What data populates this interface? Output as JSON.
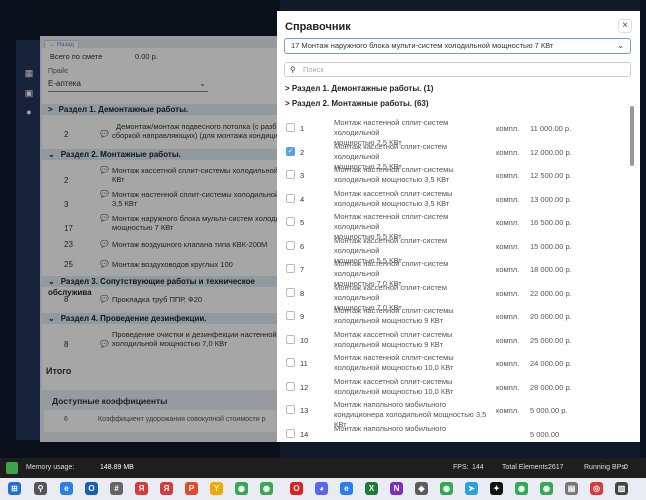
{
  "app": {
    "back_label": "Назад",
    "total_label": "Всего по смете",
    "total_value": "0.00 р.",
    "price_label": "Прайс",
    "price_value": "Е-аптека",
    "itogo": "Итого",
    "coef_title": "Доступные коэффициенты",
    "coef_num": "6",
    "coef_text": "Коэффициент удорожания совокупной стоимости р",
    "sections": [
      {
        "label": "Раздел 1. Демонтажные работы."
      },
      {
        "label": "Раздел 2. Монтажные работы."
      },
      {
        "label": "Раздел 3. Сопутствующие работы и техническое обслужива"
      },
      {
        "label": "Раздел 4. Проведение дезинфекции."
      }
    ],
    "rows": [
      {
        "num": "2",
        "line1": "Демонтаж/монтаж подвесного потолка (с разбор",
        "line2": "сборкой направляющих) (для монтажа кондицио"
      },
      {
        "num": "2",
        "line1": "Монтаж кассетной сплит-системы холодильной м",
        "line2": "КВт"
      },
      {
        "num": "3",
        "line1": "Монтаж настенной сплит-системы холодильной м",
        "line2": "3,5 КВт"
      },
      {
        "num": "17",
        "line1": "Монтаж наружного блока мульти-систем холоди",
        "line2": "мощностью 7 КВт"
      },
      {
        "num": "23",
        "line1": "Монтаж воздушного клапана типа КВК-200М",
        "line2": ""
      },
      {
        "num": "25",
        "line1": "Монтаж воздуховодов круглых 100",
        "line2": ""
      },
      {
        "num": "8",
        "line1": "Прокладка труб ППР, Ф20",
        "line2": ""
      },
      {
        "num": "8",
        "line1": "Проведение очистки и дезинфекции настенной с",
        "line2": "холодильной мощностью 7,0 КВт"
      }
    ]
  },
  "modal": {
    "title": "Справочник",
    "close": "×",
    "select_value": "17 Монтаж наружного блока мульти-систем холодильной мощностью 7 КВт",
    "search_placeholder": "Поиск",
    "section1": "Раздел 1. Демонтажные работы. (1)",
    "section2": "Раздел 2. Монтажные работы. (63)",
    "items": [
      {
        "num": "1",
        "l1": "Монтаж настенной сплит-систем холодильной",
        "l2": "мощностью 2,5 КВт",
        "unit": "компл.",
        "price": "11 000.00 р.",
        "checked": false
      },
      {
        "num": "2",
        "l1": "Монтаж кассетной сплит-систем холодильной",
        "l2": "мощностью 2,5 КВт",
        "unit": "компл.",
        "price": "12 000.00 р.",
        "checked": true
      },
      {
        "num": "3",
        "l1": "Монтаж настенной сплит-системы",
        "l2": "холодильной мощностью 3,5 КВт",
        "unit": "компл.",
        "price": "12 500.00 р.",
        "checked": false
      },
      {
        "num": "4",
        "l1": "Монтаж кассетной сплит-системы",
        "l2": "холодильной мощностью 3,5 КВт",
        "unit": "компл.",
        "price": "13 000.00 р.",
        "checked": false
      },
      {
        "num": "5",
        "l1": "Монтаж настенной сплит-систем холодильной",
        "l2": "мощностью 5,5 КВт",
        "unit": "компл.",
        "price": "16 500.00 р.",
        "checked": false
      },
      {
        "num": "6",
        "l1": "Монтаж кассетной сплит-систем холодильной",
        "l2": "мощностью 5,5 КВт",
        "unit": "компл.",
        "price": "15 000.00 р.",
        "checked": false
      },
      {
        "num": "7",
        "l1": "Монтаж настенной сплит-систем холодильной",
        "l2": "мощностью 7,0 КВт",
        "unit": "компл.",
        "price": "18 000.00 р.",
        "checked": false
      },
      {
        "num": "8",
        "l1": "Монтаж кассетной сплит-систем холодильной",
        "l2": "мощностью 7,0 КВт",
        "unit": "компл.",
        "price": "22 000.00 р.",
        "checked": false
      },
      {
        "num": "9",
        "l1": "Монтаж настенной сплит-системы",
        "l2": "холодильной мощностью 9 КВт",
        "unit": "компл.",
        "price": "20 000.00 р.",
        "checked": false
      },
      {
        "num": "10",
        "l1": "Монтаж кассетной сплит-системы",
        "l2": "холодильной мощностью 9 КВт",
        "unit": "компл.",
        "price": "25 000.00 р.",
        "checked": false
      },
      {
        "num": "11",
        "l1": "Монтаж настенной сплит-системы",
        "l2": "холодильной мощностью 10,0 КВт",
        "unit": "компл.",
        "price": "24 000.00 р.",
        "checked": false
      },
      {
        "num": "12",
        "l1": "Монтаж кассетной сплит-системы",
        "l2": "холодильной мощностью 10,0 КВт",
        "unit": "компл.",
        "price": "28 000.00 р.",
        "checked": false
      },
      {
        "num": "13",
        "l1": "Монтаж напольного мобильного",
        "l2": "кондиционера холодильной мощностью 3,5",
        "l3": "КВт",
        "unit": "компл.",
        "price": "5 000.00 р.",
        "checked": false
      },
      {
        "num": "14",
        "l1": "Монтаж напольного мобильного",
        "l2": "",
        "unit": "",
        "price": "5 000.00",
        "checked": false
      }
    ]
  },
  "status": {
    "memory_label": "Memory usage:",
    "memory_value": "148.89 MB",
    "fps_label": "FPS:",
    "fps_value": "144",
    "elements_label": "Total Elements:",
    "elements_value": "2617",
    "bps_label": "Running BPs:",
    "bps_value": "0"
  }
}
